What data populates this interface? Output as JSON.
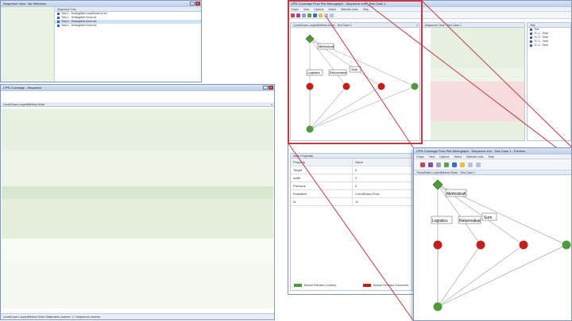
{
  "left_top_window": {
    "title": "Sequence View - No Selection",
    "panel_title": "Sequence Tree",
    "tree_items": [
      "Test.1 - TestingMidi.LoadSolveList.kd",
      "Test.2 - TestingMidi.Solve.kd",
      "Test.3 - TestingMidi.Solve.kd",
      "Test.4 - TestingMidi.Solve.kd"
    ]
  },
  "left_bottom_window": {
    "title": "CPN Coverage - Sequence",
    "panel_title": "CountDown.LoopedMethod.Solve",
    "status": "CountDown.LoopedMethod.Solve  Statements covered: 1 / Sequences covered"
  },
  "right_back_window": {
    "title": "CPN Coverage Flow Plot Monograph - Sequence.xml - Test Case 1",
    "menu": [
      "Graph",
      "View",
      "Options",
      "Select",
      "Website Links",
      "Help"
    ],
    "graph_panel_title": "CountDown.LoopedMethod.Solve - Test Case 1",
    "code_panel_title": "Sequence View - Test Case 1",
    "tree_panel_title": "Test",
    "tree_items": [
      "Test",
      "TC.1 - Testi",
      "TC.2 - Testi",
      "TC.3 - Testi",
      "TC.4 - Testi"
    ]
  },
  "grid_panel": {
    "title": "Node Properties",
    "header": [
      "Property",
      "Value"
    ],
    "rows": [
      [
        "Target",
        "0"
      ],
      [
        "width",
        "2"
      ],
      [
        "Previous",
        "0"
      ],
      [
        "Flowtitled",
        "CountDown.Flow"
      ],
      [
        "Id",
        "11"
      ]
    ]
  },
  "legend": {
    "covered": "Branch Remains Covered",
    "uncovered": "Branch Remains Uncovered"
  },
  "right_front_window": {
    "title": "CPN Coverage Flow Plot Monograph - Sequence.xml - Test Case 1 - Preview",
    "menu": [
      "Graph",
      "View",
      "Options",
      "Select",
      "Website Links",
      "Help"
    ],
    "panel_title": "ThreadSafe.LoopedMethod.Solve - Test Case 1",
    "node_labels": [
      "Methodcall",
      "Logistics",
      "Returnvalue",
      "Sum"
    ]
  },
  "graph_back_labels": [
    "Methodcall",
    "Logistics",
    "Returnvalue",
    "Sum"
  ],
  "colors": {
    "covered": "#4f9b3c",
    "uncovered": "#c0211d",
    "highlight": "#c43a44",
    "titlebar": "#b9cbe6"
  }
}
